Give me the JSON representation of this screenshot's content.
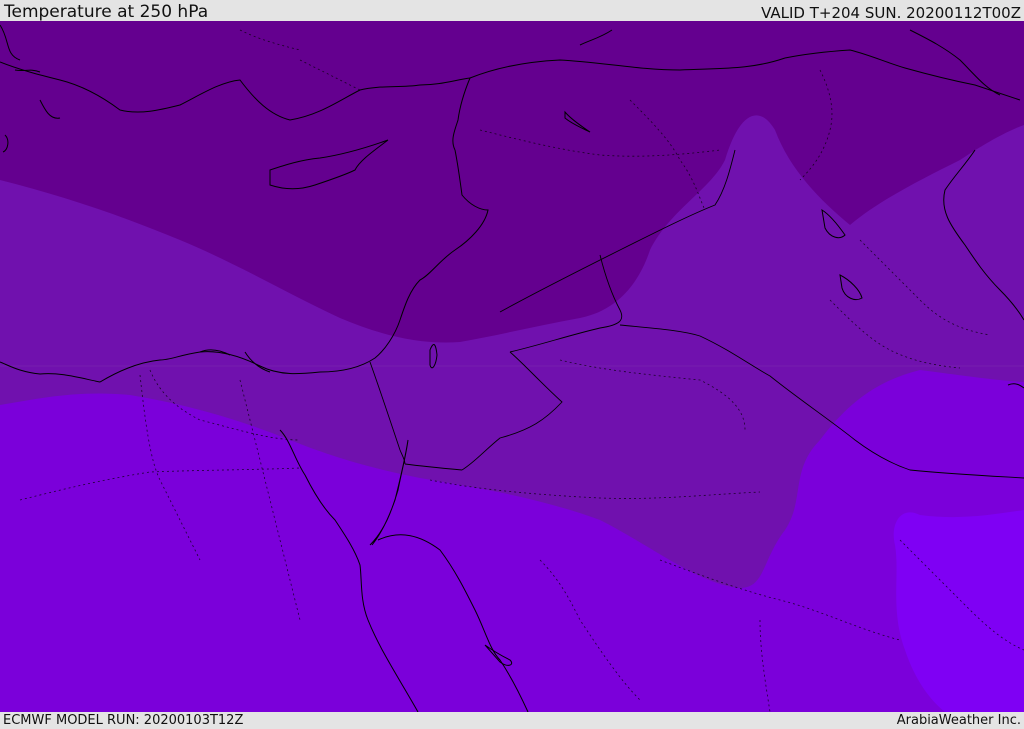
{
  "header": {
    "title": "Temperature at 250 hPa",
    "valid": "VALID T+204 SUN. 20200112T00Z"
  },
  "footer": {
    "model_run": "ECMWF MODEL RUN: 20200103T12Z",
    "credit": "ArabiaWeather Inc."
  },
  "colors": {
    "band_darkest": "#64008f",
    "band_dark": "#7011ae",
    "band_mid": "#7b00da",
    "band_light": "#7f00f4",
    "coastline": "#000000",
    "borders": "#000000",
    "frame": "#e4e4e4"
  }
}
